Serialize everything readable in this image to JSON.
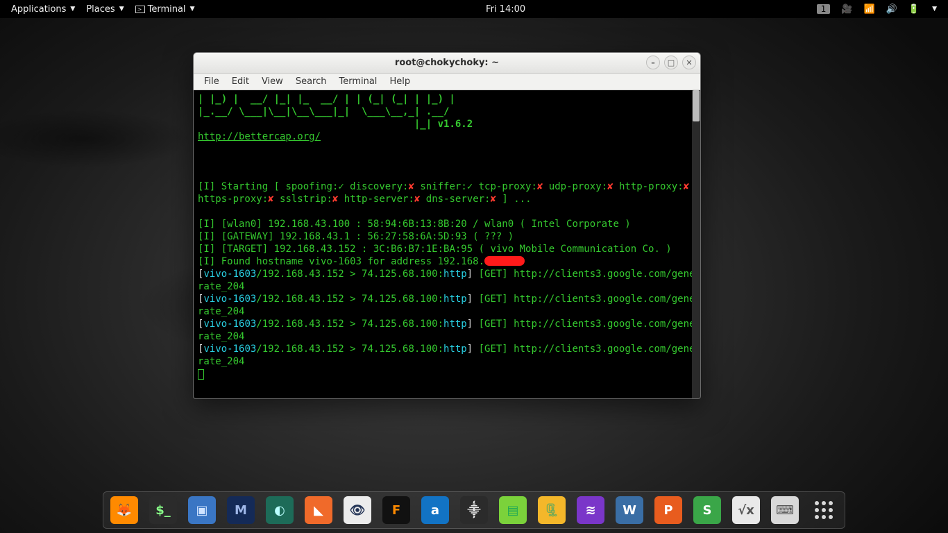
{
  "topbar": {
    "applications": "Applications",
    "places": "Places",
    "terminal": "Terminal",
    "clock": "Fri 14:00",
    "workspace": "1"
  },
  "window": {
    "title": "root@chokychoky: ~",
    "menu": {
      "file": "File",
      "edit": "Edit",
      "view": "View",
      "search": "Search",
      "terminal": "Terminal",
      "help": "Help"
    }
  },
  "term": {
    "ascii_line1": "| |_) |  __/ |_| |_  __/ | | (_| (_| | |_) |",
    "ascii_line2": "|_.__/ \\___|\\__|\\__\\___|_|  \\___\\__,_| .__/",
    "ascii_line3": "                                     |_| ",
    "version": "v1.6.2",
    "url": "http://bettercap.org/",
    "start_prefix": "[I]",
    "start_text1": " Starting [ spoofing:",
    "start_text2": " discovery:",
    "start_text3": " sniffer:",
    "start_text4": " tcp-proxy:",
    "start_text5": " udp-proxy:",
    "start_text6": " http-proxy:",
    "start_text7": " https-proxy:",
    "start_text8": " sslstrip:",
    "start_text9": " http-server:",
    "start_text10": " dns-server:",
    "start_tail": " ] ...",
    "chk": "✓",
    "crs": "✘",
    "line_wlan": " [wlan0] 192.168.43.100 : 58:94:6B:13:8B:20 / wlan0 ( Intel Corporate )",
    "line_gw": " [GATEWAY] 192.168.43.1 : 56:27:58:6A:5D:93 ( ??? )",
    "line_tgt": " [TARGET] 192.168.43.152 : 3C:B6:B7:1E:BA:95 ( vivo Mobile Communication Co. )",
    "line_host_a": " Found hostname vivo-1603 for address 192.168.",
    "req_open": "[",
    "req_host": "vivo-1603",
    "req_mid": "/192.168.43.152 > 74.125.68.100:",
    "req_proto": "http",
    "req_close": "] ",
    "req_method": "[GET] ",
    "req_url": "http://clients3.google.com/generate_204"
  },
  "dock": {
    "items": [
      {
        "name": "firefox",
        "bg": "#ff8a00",
        "fg": "#fff",
        "label": "🦊"
      },
      {
        "name": "terminal",
        "bg": "#2b2b2b",
        "fg": "#8f8",
        "label": "$_"
      },
      {
        "name": "files",
        "bg": "#3a76c4",
        "fg": "#cfe3ff",
        "label": "▣"
      },
      {
        "name": "metasploit",
        "bg": "#142a57",
        "fg": "#9fb7e8",
        "label": "M"
      },
      {
        "name": "armitage",
        "bg": "#1d6b58",
        "fg": "#bff",
        "label": "◐"
      },
      {
        "name": "burpsuite",
        "bg": "#f06a2a",
        "fg": "#fff",
        "label": "◣"
      },
      {
        "name": "zenmap",
        "bg": "#ececec",
        "fg": "#235",
        "label": "👁"
      },
      {
        "name": "faraday",
        "bg": "#111",
        "fg": "#ff8a00",
        "label": "F"
      },
      {
        "name": "app-blue",
        "bg": "#1273c4",
        "fg": "#fff",
        "label": "a"
      },
      {
        "name": "kdenlive",
        "bg": "#2b2b2b",
        "fg": "#eee",
        "label": "⸎"
      },
      {
        "name": "leafpad",
        "bg": "#7bd23b",
        "fg": "#2a5",
        "label": "▤"
      },
      {
        "name": "archive",
        "bg": "#f4b72a",
        "fg": "#7a5",
        "label": "🗜"
      },
      {
        "name": "database",
        "bg": "#7a36c9",
        "fg": "#fff",
        "label": "≋"
      },
      {
        "name": "wireshark",
        "bg": "#3a6ea5",
        "fg": "#fff",
        "label": "W"
      },
      {
        "name": "presentation",
        "bg": "#e85c1e",
        "fg": "#fff",
        "label": "P"
      },
      {
        "name": "spreadsheet",
        "bg": "#3aa648",
        "fg": "#fff",
        "label": "S"
      },
      {
        "name": "math",
        "bg": "#e9e9e9",
        "fg": "#555",
        "label": "√x"
      },
      {
        "name": "keyboard",
        "bg": "#d9d9d9",
        "fg": "#555",
        "label": "⌨"
      }
    ]
  }
}
